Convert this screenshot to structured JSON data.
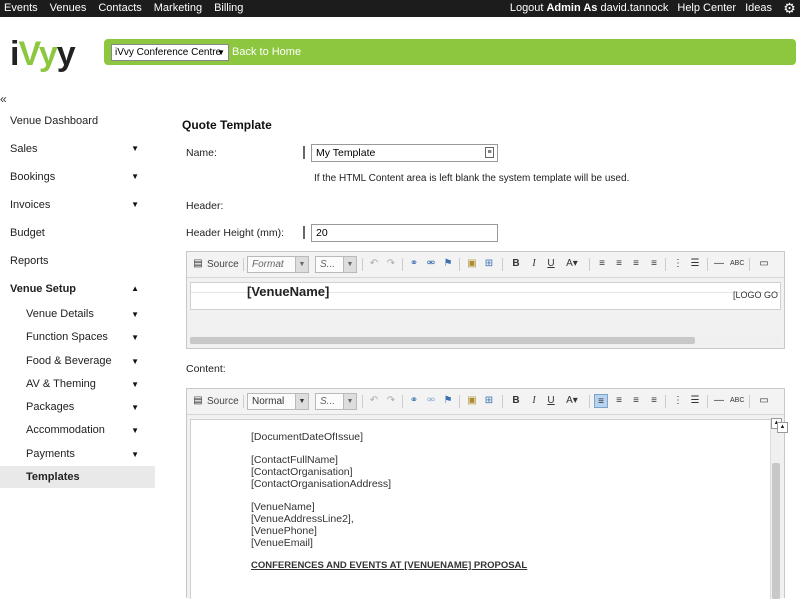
{
  "topnav": {
    "items": [
      "Events",
      "Venues",
      "Contacts",
      "Marketing",
      "Billing"
    ],
    "logout_prefix": "Logout",
    "logout_user": "Admin As",
    "logout_name": "david.tannock",
    "help": "Help Center",
    "ideas": "Ideas",
    "gear_icon": "gear-icon"
  },
  "header": {
    "logo_i": "i",
    "logo_v": "V",
    "logo_rest": "y",
    "logo_tail": "y",
    "venue_select": "iVvy Conference Centre",
    "back_home": "Back to Home"
  },
  "collapse_icon": "«",
  "sidebar": {
    "items": [
      {
        "label": "Venue Dashboard"
      },
      {
        "label": "Sales"
      },
      {
        "label": "Bookings"
      },
      {
        "label": "Invoices"
      },
      {
        "label": "Budget"
      },
      {
        "label": "Reports"
      },
      {
        "label": "Venue Setup"
      }
    ],
    "sub_items": [
      {
        "label": "Venue Details"
      },
      {
        "label": "Function Spaces"
      },
      {
        "label": "Food & Beverage"
      },
      {
        "label": "AV & Theming"
      },
      {
        "label": "Packages"
      },
      {
        "label": "Accommodation"
      },
      {
        "label": "Payments"
      },
      {
        "label": "Templates"
      }
    ]
  },
  "main": {
    "title": "Quote Template",
    "name_label": "Name:",
    "name_value": "My Template",
    "hint": "If the HTML Content area is left blank the system template will be used.",
    "header_label": "Header:",
    "header_height_label": "Header Height (mm):",
    "header_height_value": "20",
    "content_label": "Content:"
  },
  "toolbar": {
    "source": "Source",
    "format": "Format",
    "normal": "Normal",
    "size": "S..."
  },
  "header_editor": {
    "venue_name": "[VenueName]",
    "logo": "[LOGO GO"
  },
  "content_editor": {
    "lines": [
      "[DocumentDateOfIssue]",
      "[ContactFullName]",
      "[ContactOrganisation]",
      "[ContactOrganisationAddress]",
      "[VenueName]",
      "[VenueAddressLine2],",
      "[VenuePhone]",
      "[VenueEmail]"
    ],
    "heading": "CONFERENCES AND EVENTS AT [VENUENAME] PROPOSAL"
  },
  "colors": {
    "topbar": "#1c1c1c",
    "brand_green": "#8dc63f",
    "active_item": "#e9e9e9"
  }
}
